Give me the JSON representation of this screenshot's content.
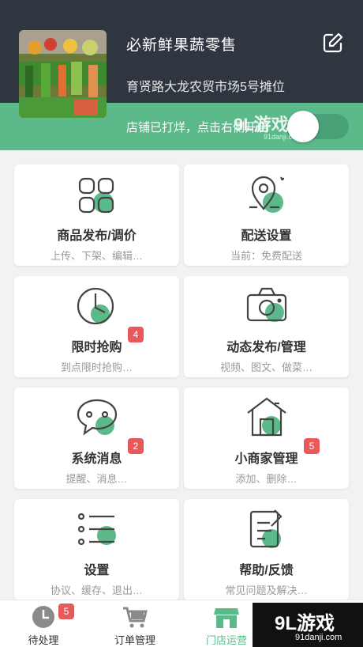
{
  "store": {
    "name": "必新鲜果蔬零售",
    "address": "育贤路大龙农贸市场5号摊位",
    "status_text": "店铺已打烊，点击右侧开启"
  },
  "accent_color": "#5cb98a",
  "cards": [
    {
      "title": "商品发布/调价",
      "subtitle": "上传、下架、编辑…",
      "icon": "grid-apps-icon"
    },
    {
      "title": "配送设置",
      "subtitle": "当前：免费配送",
      "icon": "location-pin-icon"
    },
    {
      "title": "限时抢购",
      "subtitle": "到点限时抢购…",
      "icon": "clock-icon",
      "badge": "4"
    },
    {
      "title": "动态发布/管理",
      "subtitle": "视频、图文、做菜…",
      "icon": "camera-icon"
    },
    {
      "title": "系统消息",
      "subtitle": "提醒、消息…",
      "icon": "chat-bubble-icon",
      "badge": "2"
    },
    {
      "title": "小商家管理",
      "subtitle": "添加、删除…",
      "icon": "house-icon",
      "badge": "5"
    },
    {
      "title": "设置",
      "subtitle": "协议、缓存、退出…",
      "icon": "list-settings-icon"
    },
    {
      "title": "帮助/反馈",
      "subtitle": "常见问题及解决…",
      "icon": "note-pen-icon"
    }
  ],
  "tabs": [
    {
      "label": "待处理",
      "badge": "5"
    },
    {
      "label": "订单管理"
    },
    {
      "label": "门店运营"
    }
  ],
  "watermark": {
    "top_text": "9L游戏",
    "top_sub": "91danji.com",
    "bottom_text": "9L游戏",
    "bottom_sub": "91danji.com"
  }
}
